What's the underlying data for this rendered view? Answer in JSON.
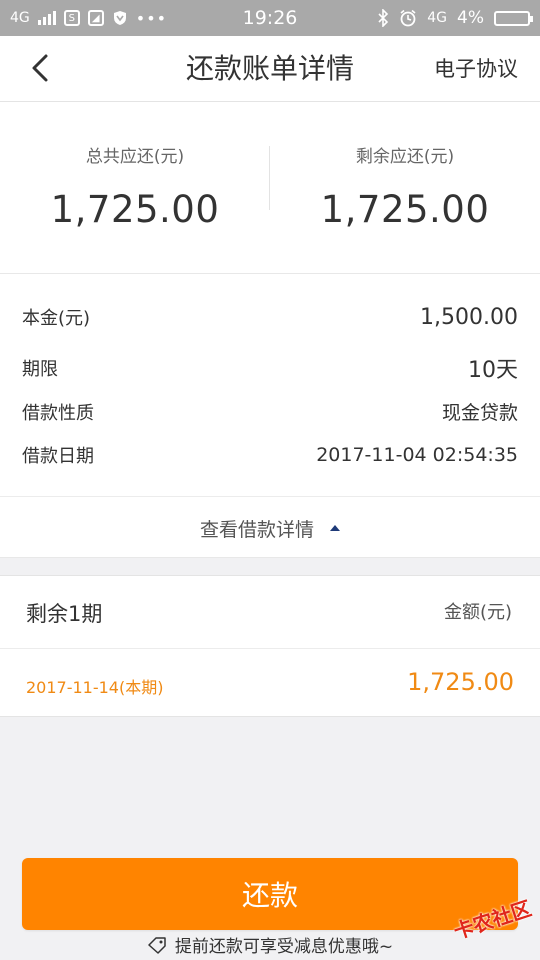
{
  "status_bar": {
    "network_left": "4G",
    "time": "19:26",
    "network_right": "4G",
    "battery": "4%",
    "icons": [
      "signal-icon",
      "s-app-icon",
      "photo-app-icon",
      "shield-app-icon",
      "more-icon",
      "bluetooth-icon",
      "alarm-icon",
      "battery-icon"
    ]
  },
  "nav": {
    "title": "还款账单详情",
    "right_link": "电子协议"
  },
  "summary": {
    "total_label": "总共应还(元)",
    "total_value": "1,725.00",
    "remaining_label": "剩余应还(元)",
    "remaining_value": "1,725.00"
  },
  "details": {
    "rows": [
      {
        "label": "本金(元)",
        "value": "1,500.00"
      },
      {
        "label": "期限",
        "value": "10天"
      },
      {
        "label": "借款性质",
        "value": "现金贷款"
      },
      {
        "label": "借款日期",
        "value": "2017-11-04 02:54:35"
      }
    ],
    "toggle_label": "查看借款详情"
  },
  "periods": {
    "title": "剩余1期",
    "amount_label": "金额(元)",
    "items": [
      {
        "date": "2017-11-14(本期)",
        "amount": "1,725.00"
      }
    ]
  },
  "action": {
    "repay_label": "还款",
    "tip": "提前还款可享受减息优惠哦~"
  },
  "watermark": "卡农社区",
  "colors": {
    "accent": "#ff8400",
    "highlight_text": "#f08a14",
    "status_bar": "#a9a9a9"
  }
}
